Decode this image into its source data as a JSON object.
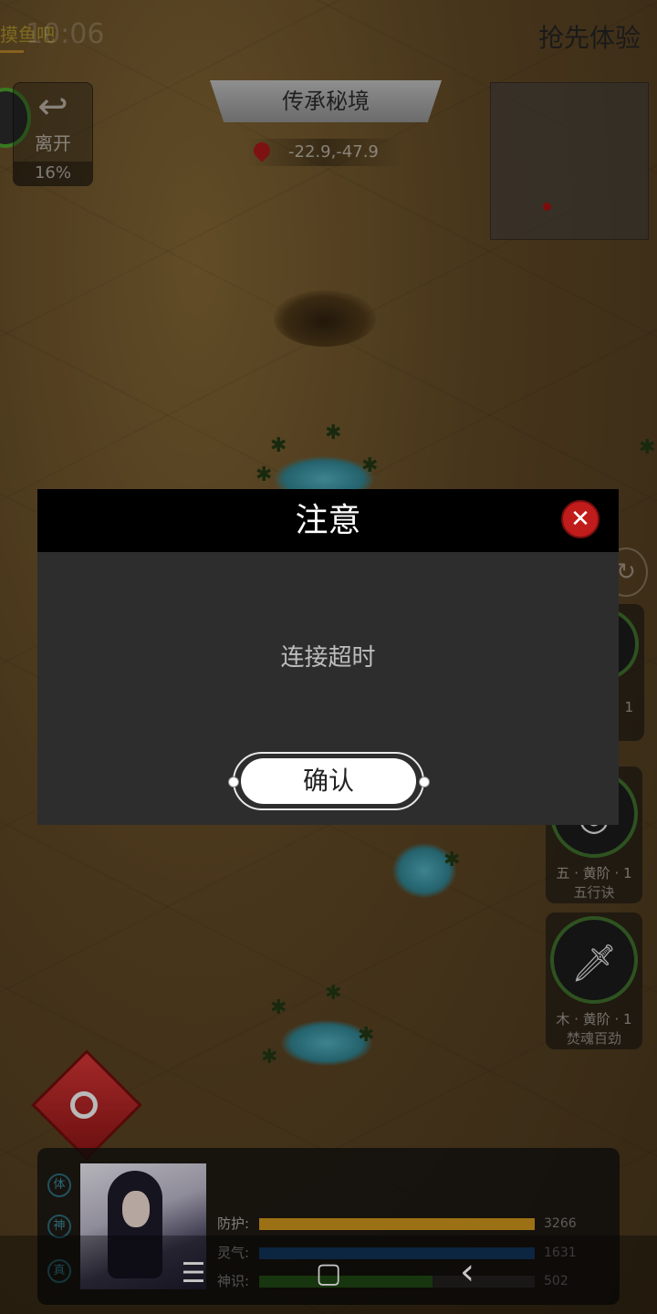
{
  "status": {
    "time": "10:06",
    "label": "摸鱼吧"
  },
  "header": {
    "early_access": "抢先体验",
    "area_name": "传承秘境",
    "coordinates": "-22.9,-47.9"
  },
  "leave": {
    "label": "离开",
    "percent": "16%",
    "icon": "undo-arrow-icon"
  },
  "skills": [
    {
      "grade": "1",
      "name": ""
    },
    {
      "grade": "五 · 黄阶 · 1",
      "name": "五行诀",
      "icon": "ripple-icon"
    },
    {
      "grade": "木 · 黄阶 · 1",
      "name": "焚魂百劲",
      "icon": "dagger-icon"
    }
  ],
  "player": {
    "stat_icons": [
      "体",
      "神",
      "真"
    ],
    "bars": [
      {
        "name": "防护:",
        "value": "3266",
        "fill": 1.0,
        "color": "#c8901a"
      },
      {
        "name": "灵气:",
        "value": "1631",
        "fill": 1.0,
        "color": "#1a4a80"
      },
      {
        "name": "神识:",
        "value": "502",
        "fill": 0.63,
        "color": "#2e6a1e"
      }
    ]
  },
  "dialog": {
    "title": "注意",
    "message": "连接超时",
    "confirm_label": "确认"
  },
  "navbar": {
    "menu_icon": "☰",
    "home_icon": "▢",
    "back_icon": "‹"
  }
}
